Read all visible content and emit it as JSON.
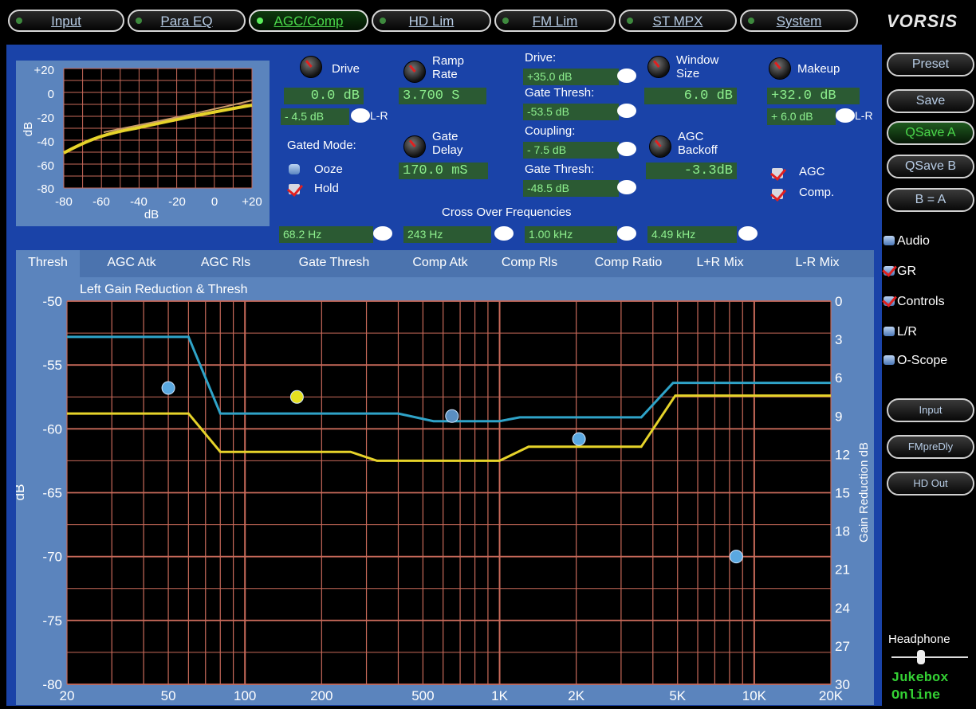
{
  "top_tabs": [
    {
      "label": "Input",
      "active": false
    },
    {
      "label": "Para EQ",
      "active": false
    },
    {
      "label": "AGC/Comp",
      "active": true
    },
    {
      "label": "HD Lim",
      "active": false
    },
    {
      "label": "FM Lim",
      "active": false
    },
    {
      "label": "ST MPX",
      "active": false
    },
    {
      "label": "System",
      "active": false
    }
  ],
  "logo": "VORSIS",
  "mini_plot": {
    "y_ticks": [
      "+20",
      "0",
      "-20",
      "-40",
      "-60",
      "-80"
    ],
    "x_ticks": [
      "-80",
      "-60",
      "-40",
      "-20",
      "0",
      "+20"
    ],
    "ylabel": "dB",
    "xlabel": "dB"
  },
  "controls": {
    "drive": {
      "label": "Drive",
      "value": "0.0 dB",
      "lr_value": "- 4.5 dB",
      "lr_label": "L-R"
    },
    "ramp_rate": {
      "label1": "Ramp",
      "label2": "Rate",
      "value": "3.700 S"
    },
    "drive2": {
      "label": "Drive:",
      "value": "+35.0 dB"
    },
    "gate_thresh1": {
      "label": "Gate Thresh:",
      "value": "-53.5 dB"
    },
    "window_size": {
      "label1": "Window",
      "label2": "Size",
      "value": "6.0 dB"
    },
    "makeup": {
      "label": "Makeup",
      "value": "+32.0 dB",
      "lr_value": "+ 6.0 dB",
      "lr_label": "L-R"
    },
    "gated_mode": {
      "label": "Gated Mode:",
      "ooze": "Ooze",
      "hold": "Hold"
    },
    "gate_delay": {
      "label1": "Gate",
      "label2": "Delay",
      "value": "170.0 mS"
    },
    "coupling": {
      "label": "Coupling:",
      "value": "- 7.5 dB"
    },
    "gate_thresh2": {
      "label": "Gate Thresh:",
      "value": "-48.5 dB"
    },
    "agc_backoff": {
      "label1": "AGC",
      "label2": "Backoff",
      "value": "-3.3dB"
    },
    "agc_check": {
      "label": "AGC",
      "checked": true
    },
    "comp_check": {
      "label": "Comp.",
      "checked": true
    },
    "crossover": {
      "label": "Cross Over Frequencies",
      "values": [
        "68.2 Hz",
        "243 Hz",
        "1.00 kHz",
        "4.49 kHz"
      ]
    }
  },
  "lower_tabs": [
    "Thresh",
    "AGC Atk",
    "AGC Rls",
    "Gate Thresh",
    "Comp Atk",
    "Comp Rls",
    "Comp Ratio",
    "L+R Mix",
    "L-R Mix"
  ],
  "side_buttons": {
    "preset": "Preset",
    "save": "Save",
    "qsave_a": "QSave A",
    "qsave_b": "QSave B",
    "b_eq_a": "B = A",
    "input": "Input",
    "fmpredly": "FMpreDly",
    "hd_out": "HD Out"
  },
  "side_items": [
    {
      "label": "Audio",
      "checked": false
    },
    {
      "label": "GR",
      "checked": true
    },
    {
      "label": "Controls",
      "checked": true
    },
    {
      "label": "L/R",
      "checked": false
    },
    {
      "label": "O-Scope",
      "checked": false
    }
  ],
  "headphone": {
    "label": "Headphone",
    "line1": "Jukebox",
    "line2": "Online"
  },
  "colors": {
    "panel": "#1a43a8",
    "grid": "#c86a5a",
    "cyan": "#2fa3c8",
    "yellow": "#e6d32a",
    "value_text": "#8ef08e"
  },
  "chart_data": {
    "type": "line",
    "title": "Left Gain Reduction & Thresh",
    "ylabel": "dB",
    "y2label": "Gain Reduction dB",
    "x_scale": "log",
    "xlim": [
      20,
      20000
    ],
    "ylim": [
      -80,
      -50
    ],
    "y2lim": [
      30,
      0
    ],
    "x_ticks": [
      {
        "v": 20,
        "t": "20"
      },
      {
        "v": 50,
        "t": "50"
      },
      {
        "v": 100,
        "t": "100"
      },
      {
        "v": 200,
        "t": "200"
      },
      {
        "v": 500,
        "t": "500"
      },
      {
        "v": 1000,
        "t": "1K"
      },
      {
        "v": 2000,
        "t": "2K"
      },
      {
        "v": 5000,
        "t": "5K"
      },
      {
        "v": 10000,
        "t": "10K"
      },
      {
        "v": 20000,
        "t": "20K"
      }
    ],
    "y_ticks": [
      {
        "v": -50,
        "t": "-50"
      },
      {
        "v": -55,
        "t": "-55"
      },
      {
        "v": -60,
        "t": "-60"
      },
      {
        "v": -65,
        "t": "-65"
      },
      {
        "v": -70,
        "t": "-70"
      },
      {
        "v": -75,
        "t": "-75"
      },
      {
        "v": -80,
        "t": "-80"
      }
    ],
    "y2_ticks": [
      {
        "v": 0,
        "t": "0"
      },
      {
        "v": 3,
        "t": "3"
      },
      {
        "v": 6,
        "t": "6"
      },
      {
        "v": 9,
        "t": "9"
      },
      {
        "v": 12,
        "t": "12"
      },
      {
        "v": 15,
        "t": "15"
      },
      {
        "v": 18,
        "t": "18"
      },
      {
        "v": 21,
        "t": "21"
      },
      {
        "v": 24,
        "t": "24"
      },
      {
        "v": 27,
        "t": "27"
      },
      {
        "v": 30,
        "t": "30"
      }
    ],
    "series": [
      {
        "color": "#2fa3c8",
        "points": [
          [
            20,
            -52.8
          ],
          [
            60,
            -52.8
          ],
          [
            80,
            -58.8
          ],
          [
            400,
            -58.8
          ],
          [
            550,
            -59.4
          ],
          [
            1000,
            -59.4
          ],
          [
            1200,
            -59.1
          ],
          [
            3600,
            -59.1
          ],
          [
            4800,
            -56.4
          ],
          [
            20000,
            -56.4
          ]
        ]
      },
      {
        "color": "#e6d32a",
        "points": [
          [
            20,
            -58.8
          ],
          [
            60,
            -58.8
          ],
          [
            80,
            -61.8
          ],
          [
            260,
            -61.8
          ],
          [
            330,
            -62.5
          ],
          [
            1000,
            -62.5
          ],
          [
            1300,
            -61.4
          ],
          [
            3600,
            -61.4
          ],
          [
            4900,
            -57.4
          ],
          [
            20000,
            -57.4
          ]
        ]
      }
    ],
    "markers": [
      {
        "x": 50,
        "y": -56.8,
        "color": "#5aa8e0"
      },
      {
        "x": 160,
        "y": -57.5,
        "color": "#e6e020"
      },
      {
        "x": 650,
        "y": -59.0,
        "color": "#5a8ec0"
      },
      {
        "x": 2050,
        "y": -60.8,
        "color": "#5aa8e0"
      },
      {
        "x": 8500,
        "y": -70.0,
        "color": "#5aa8e0"
      }
    ]
  }
}
